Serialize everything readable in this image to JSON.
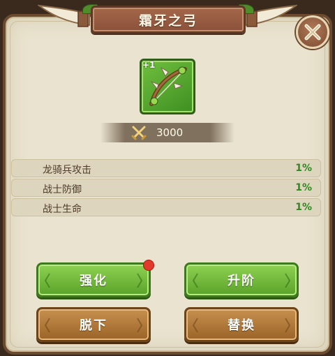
{
  "title": "霜牙之弓",
  "item": {
    "enhance_level": "+1",
    "icon": "bow-icon",
    "frame_color": "#4f9a2a"
  },
  "power": {
    "icon": "crossed-swords-icon",
    "value": "3000"
  },
  "stats": [
    {
      "label": "龙骑兵攻击",
      "value": "1%"
    },
    {
      "label": "战士防御",
      "value": "1%"
    },
    {
      "label": "战士生命",
      "value": "1%"
    }
  ],
  "buttons": {
    "enhance": "强化",
    "upgrade": "升阶",
    "unequip": "脱下",
    "replace": "替换"
  },
  "colors": {
    "green_button": "#6fb83a",
    "brown_button": "#b57a3c",
    "stat_value": "#2d8a1f",
    "notification_dot": "#e23a2a"
  }
}
